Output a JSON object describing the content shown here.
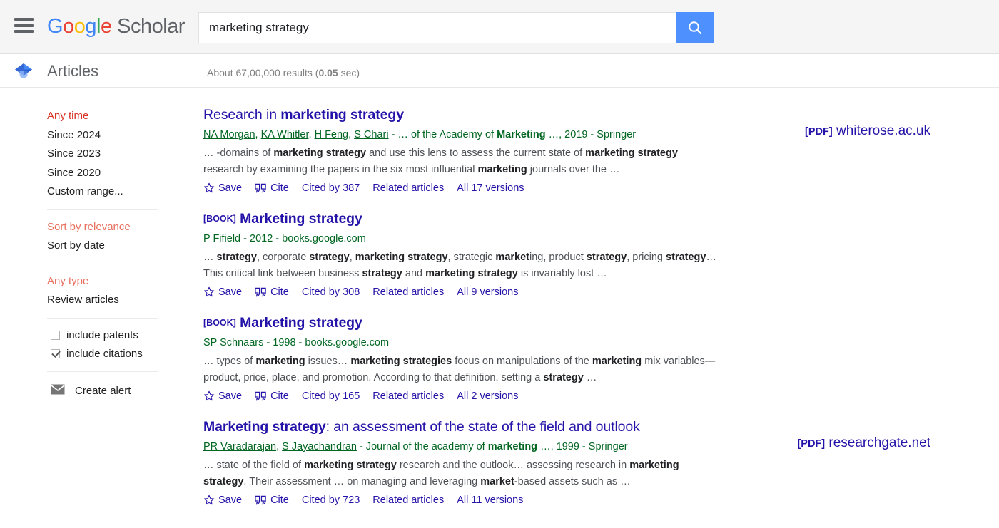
{
  "header": {
    "menu_icon": "hamburger-menu-icon",
    "brand": {
      "google": "Google",
      "scholar": "Scholar"
    },
    "search": {
      "value": "marketing strategy",
      "placeholder": "",
      "button_icon": "search-icon"
    }
  },
  "subheader": {
    "scholar_icon": "scholar-cap-icon",
    "articles_label": "Articles",
    "results_prefix": "About 67,00,000 results (",
    "results_time": "0.05",
    "results_suffix": " sec)"
  },
  "sidebar": {
    "time_filters": [
      {
        "label": "Any time",
        "active": true
      },
      {
        "label": "Since 2024",
        "active": false
      },
      {
        "label": "Since 2023",
        "active": false
      },
      {
        "label": "Since 2020",
        "active": false
      },
      {
        "label": "Custom range...",
        "active": false
      }
    ],
    "sort_filters": [
      {
        "label": "Sort by relevance",
        "active": true
      },
      {
        "label": "Sort by date",
        "active": false
      }
    ],
    "type_filters": [
      {
        "label": "Any type",
        "active": true
      },
      {
        "label": "Review articles",
        "active": false
      }
    ],
    "checkboxes": [
      {
        "label": "include patents",
        "checked": false
      },
      {
        "label": "include citations",
        "checked": true
      }
    ],
    "alert": {
      "label": "Create alert",
      "icon": "envelope-icon"
    }
  },
  "results": [
    {
      "booktag": "",
      "title_plain": "Research in ",
      "title_bold": "marketing strategy",
      "title_tail": "",
      "authors": [
        "NA Morgan",
        "KA Whitler",
        "H Feng",
        "S Chari"
      ],
      "meta_tail": " - … of the Academy of ",
      "meta_bold": "Marketing",
      "meta_end": " …, 2019 - Springer",
      "snippet_parts": [
        {
          "t": "… -domains of ",
          "b": false
        },
        {
          "t": "marketing strategy",
          "b": true
        },
        {
          "t": " and use this lens to assess the current state of ",
          "b": false
        },
        {
          "t": "marketing strategy",
          "b": true
        },
        {
          "t": " research by examining the papers in the six most influential ",
          "b": false
        },
        {
          "t": "marketing",
          "b": true
        },
        {
          "t": " journals over the …",
          "b": false
        }
      ],
      "actions": {
        "save": "Save",
        "cite": "Cite",
        "cited_by": "Cited by 387",
        "related": "Related articles",
        "versions": "All 17 versions"
      },
      "pdf": {
        "tag": "[PDF]",
        "domain": "whiterose.ac.uk"
      }
    },
    {
      "booktag": "[BOOK]",
      "title_plain": "",
      "title_bold": "Marketing strategy",
      "title_tail": "",
      "authors": [],
      "meta_tail": "P Fifield - 2012 - books.google.com",
      "meta_bold": "",
      "meta_end": "",
      "snippet_parts": [
        {
          "t": "… ",
          "b": false
        },
        {
          "t": "strategy",
          "b": true
        },
        {
          "t": ", corporate ",
          "b": false
        },
        {
          "t": "strategy",
          "b": true
        },
        {
          "t": ", ",
          "b": false
        },
        {
          "t": "marketing strategy",
          "b": true
        },
        {
          "t": ", strategic ",
          "b": false
        },
        {
          "t": "market",
          "b": true
        },
        {
          "t": "ing, product ",
          "b": false
        },
        {
          "t": "strategy",
          "b": true
        },
        {
          "t": ", pricing ",
          "b": false
        },
        {
          "t": "strategy",
          "b": true
        },
        {
          "t": "… This critical link between business ",
          "b": false
        },
        {
          "t": "strategy",
          "b": true
        },
        {
          "t": " and ",
          "b": false
        },
        {
          "t": "marketing strategy",
          "b": true
        },
        {
          "t": " is invariably lost …",
          "b": false
        }
      ],
      "actions": {
        "save": "Save",
        "cite": "Cite",
        "cited_by": "Cited by 308",
        "related": "Related articles",
        "versions": "All 9 versions"
      },
      "pdf": null
    },
    {
      "booktag": "[BOOK]",
      "title_plain": "",
      "title_bold": "Marketing strategy",
      "title_tail": "",
      "authors": [],
      "meta_tail": "SP Schnaars - 1998 - books.google.com",
      "meta_bold": "",
      "meta_end": "",
      "snippet_parts": [
        {
          "t": "… types of ",
          "b": false
        },
        {
          "t": "marketing",
          "b": true
        },
        {
          "t": " issues… ",
          "b": false
        },
        {
          "t": "marketing strategies",
          "b": true
        },
        {
          "t": " focus on manipulations of the ",
          "b": false
        },
        {
          "t": "marketing",
          "b": true
        },
        {
          "t": " mix variables—product, price, place, and promotion. According to that definition, setting a ",
          "b": false
        },
        {
          "t": "strategy",
          "b": true
        },
        {
          "t": " …",
          "b": false
        }
      ],
      "actions": {
        "save": "Save",
        "cite": "Cite",
        "cited_by": "Cited by 165",
        "related": "Related articles",
        "versions": "All 2 versions"
      },
      "pdf": null
    },
    {
      "booktag": "",
      "title_plain": "",
      "title_bold": "Marketing strategy",
      "title_tail": ": an assessment of the state of the field and outlook",
      "authors": [
        "PR Varadarajan",
        "S Jayachandran"
      ],
      "meta_tail": " - Journal of the academy of ",
      "meta_bold": "marketing",
      "meta_end": " …, 1999 - Springer",
      "snippet_parts": [
        {
          "t": "… state of the field of ",
          "b": false
        },
        {
          "t": "marketing strategy",
          "b": true
        },
        {
          "t": " research and the outlook… assessing research in ",
          "b": false
        },
        {
          "t": "marketing strategy",
          "b": true
        },
        {
          "t": ". Their assessment … on managing and leveraging ",
          "b": false
        },
        {
          "t": "market",
          "b": true
        },
        {
          "t": "-based assets such as …",
          "b": false
        }
      ],
      "actions": {
        "save": "Save",
        "cite": "Cite",
        "cited_by": "Cited by 723",
        "related": "Related articles",
        "versions": "All 11 versions"
      },
      "pdf": {
        "tag": "[PDF]",
        "domain": "researchgate.net"
      }
    }
  ],
  "colors": {
    "link": "#2413a8",
    "green": "#006621",
    "accent_red": "#d93025",
    "search_button": "#4d90fe"
  }
}
